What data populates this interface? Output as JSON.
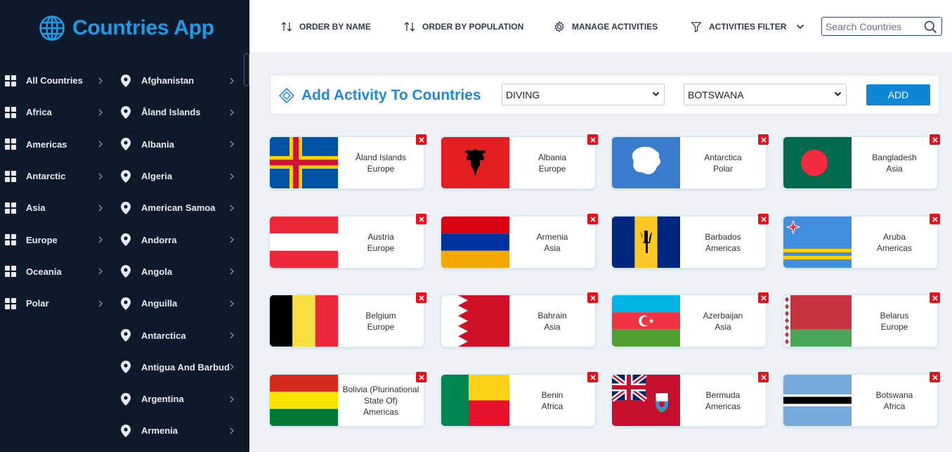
{
  "app": {
    "title": "Countries App",
    "logo_icon": "globe-icon",
    "accent": "#1e9be8"
  },
  "regions": [
    {
      "label": "All Countries"
    },
    {
      "label": "Africa"
    },
    {
      "label": "Americas"
    },
    {
      "label": "Antarctic"
    },
    {
      "label": "Asia"
    },
    {
      "label": "Europe"
    },
    {
      "label": "Oceania"
    },
    {
      "label": "Polar"
    }
  ],
  "countries_list": [
    {
      "label": "Afghanistan"
    },
    {
      "label": "Åland Islands"
    },
    {
      "label": "Albania"
    },
    {
      "label": "Algeria"
    },
    {
      "label": "American Samoa"
    },
    {
      "label": "Andorra"
    },
    {
      "label": "Angola"
    },
    {
      "label": "Anguilla"
    },
    {
      "label": "Antarctica"
    },
    {
      "label": "Antigua And Barbud"
    },
    {
      "label": "Argentina"
    },
    {
      "label": "Armenia"
    }
  ],
  "toolbar": {
    "order_name": "ORDER BY NAME",
    "order_population": "ORDER BY POPULATION",
    "manage_activities": "MANAGE ACTIVITIES",
    "activities_filter": "ACTIVITIES FILTER",
    "search_placeholder": "Search Countries"
  },
  "add_activity": {
    "title": "Add Activity To Countries",
    "activity_selected": "DIVING",
    "country_selected": "BOTSWANA",
    "add_label": "ADD"
  },
  "cards": [
    {
      "name": "Åland Islands",
      "region": "Europe",
      "flag": "aland"
    },
    {
      "name": "Albania",
      "region": "Europe",
      "flag": "albania"
    },
    {
      "name": "Antarctica",
      "region": "Polar",
      "flag": "antarctica"
    },
    {
      "name": "Bangladesh",
      "region": "Asia",
      "flag": "bangladesh"
    },
    {
      "name": "Austria",
      "region": "Europe",
      "flag": "austria"
    },
    {
      "name": "Armenia",
      "region": "Asia",
      "flag": "armenia"
    },
    {
      "name": "Barbados",
      "region": "Americas",
      "flag": "barbados"
    },
    {
      "name": "Aruba",
      "region": "Americas",
      "flag": "aruba"
    },
    {
      "name": "Belgium",
      "region": "Europe",
      "flag": "belgium"
    },
    {
      "name": "Bahrain",
      "region": "Asia",
      "flag": "bahrain"
    },
    {
      "name": "Azerbaijan",
      "region": "Asia",
      "flag": "azerbaijan"
    },
    {
      "name": "Belarus",
      "region": "Europe",
      "flag": "belarus"
    },
    {
      "name": "Bolivia (Plurinational State Of)",
      "region": "Americas",
      "flag": "bolivia"
    },
    {
      "name": "Benin",
      "region": "Africa",
      "flag": "benin"
    },
    {
      "name": "Bermuda",
      "region": "Americas",
      "flag": "bermuda"
    },
    {
      "name": "Botswana",
      "region": "Africa",
      "flag": "botswana"
    }
  ]
}
